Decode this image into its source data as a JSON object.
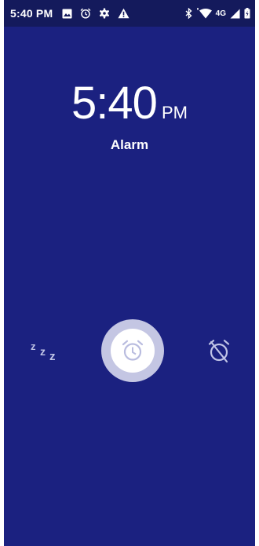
{
  "status_bar": {
    "time": "5:40 PM",
    "network": "4G",
    "icons": [
      "image-icon",
      "alarm-clock-icon",
      "settings-gear-icon",
      "warning-icon",
      "bluetooth-icon",
      "wifi-icon",
      "signal-icon",
      "battery-icon"
    ]
  },
  "clock": {
    "time": "5:40",
    "ampm": "PM"
  },
  "alarm": {
    "label": "Alarm"
  },
  "actions": {
    "snooze_icon": "snooze-icon",
    "dismiss_icon": "alarm-clock-icon",
    "alarm_off_icon": "alarm-off-icon"
  },
  "colors": {
    "background": "#1b2180",
    "status_bar": "#141a5c",
    "dismiss_ring": "#c4c6e3",
    "icon_muted": "#c0c4e6"
  }
}
